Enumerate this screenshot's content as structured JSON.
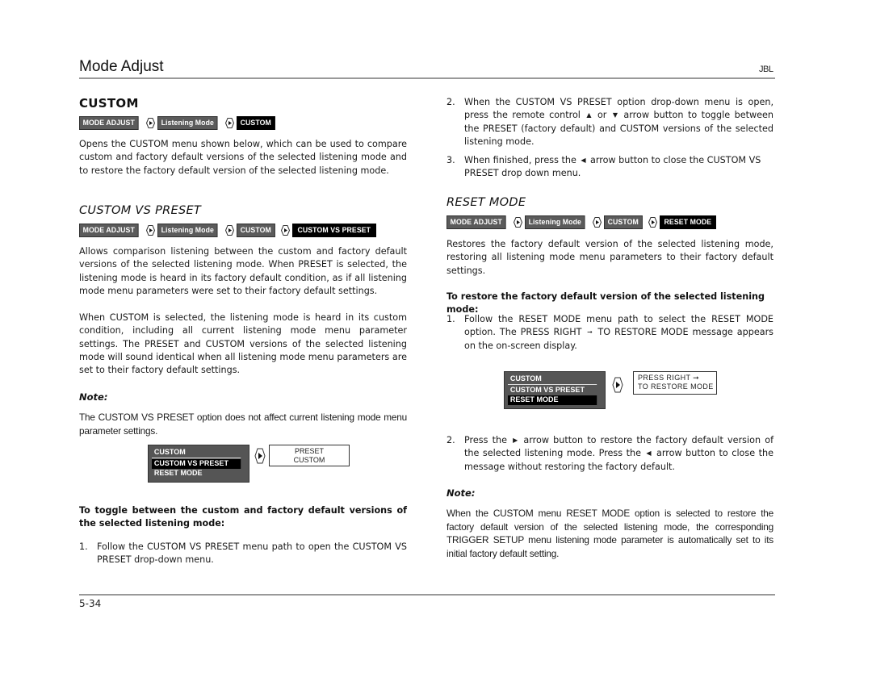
{
  "header": {
    "title": "Mode Adjust",
    "brand": "JBL"
  },
  "footer": {
    "page_number": "5-34"
  },
  "left": {
    "custom": {
      "heading": "CUSTOM",
      "breadcrumb": [
        "MODE ADJUST",
        "Listening Mode",
        "CUSTOM"
      ],
      "body": "Opens the CUSTOM menu shown below, which can be used to compare custom and factory default versions of the selected listening mode and to restore the factory default version of the selected listening mode."
    },
    "custom_vs_preset": {
      "heading": "CUSTOM VS PRESET",
      "breadcrumb": [
        "MODE ADJUST",
        "Listening Mode",
        "CUSTOM",
        "CUSTOM VS PRESET"
      ],
      "para1": "Allows comparison listening between the custom and factory default versions of the selected listening mode. When PRESET is selected, the listening mode is heard in its factory default condition, as if all listening mode menu parameters were set to their factory default settings.",
      "para2": "When CUSTOM is selected, the listening mode is heard in its custom condition, including all current listening mode menu parameter settings. The PRESET and CUSTOM versions of the selected listening mode will sound identical when all listening mode menu parameters are set to their factory default settings.",
      "note_label": "Note:",
      "note_text": "The CUSTOM VS PRESET option does not affect current listening mode menu parameter settings.",
      "menu": {
        "items": [
          "CUSTOM",
          "CUSTOM VS PRESET",
          "RESET MODE"
        ],
        "selected_index": 1
      },
      "display": [
        "PRESET",
        "CUSTOM"
      ],
      "procedure_title": "To toggle between the custom and factory default versions of the selected listening mode:",
      "steps": [
        {
          "num": "1.",
          "text": "Follow the CUSTOM VS PRESET menu path to open the CUSTOM VS PRESET drop-down menu."
        }
      ]
    }
  },
  "right": {
    "steps_cont": [
      {
        "num": "2.",
        "pre": "When the CUSTOM VS PRESET option drop-down menu is open, press the remote control ",
        "arrow1": "▲",
        "mid": " or ",
        "arrow2": "▼",
        "post": " arrow button to toggle between the PRESET (factory default) and CUSTOM versions of the selected listening mode."
      },
      {
        "num": "3.",
        "pre": "When finished, press the ",
        "arrow1": "◀",
        "post": " arrow button to close the CUSTOM VS PRESET drop down menu."
      }
    ],
    "reset_mode": {
      "heading": "RESET MODE",
      "breadcrumb": [
        "MODE ADJUST",
        "Listening Mode",
        "CUSTOM",
        "RESET MODE"
      ],
      "body": "Restores the factory default version of the selected listening mode, restoring all listening mode menu parameters to their factory default settings.",
      "procedure_title": "To restore the factory default version of the selected listening mode:",
      "step1": {
        "num": "1.",
        "pre": "Follow the RESET MODE menu path to select the RESET MODE option. The PRESS RIGHT ",
        "arrow": "➞",
        "post": " TO RESTORE MODE message appears on the on-screen display."
      },
      "menu": {
        "items": [
          "CUSTOM",
          "CUSTOM VS PRESET",
          "RESET MODE"
        ],
        "selected_index": 2
      },
      "display": [
        "PRESS RIGHT ➞",
        "TO RESTORE MODE"
      ],
      "step2": {
        "num": "2.",
        "pre": "Press the ",
        "arrow1": "▶",
        "mid": " arrow button to restore the factory default version of the selected listening mode. Press the ",
        "arrow2": "◀",
        "post": " arrow button to close the message without restoring the factory default."
      },
      "note_label": "Note:",
      "note_text": "When the CUSTOM menu RESET MODE option is selected to restore the factory default version of the selected listening mode, the corresponding TRIGGER SETUP menu listening mode parameter is automatically set to its initial factory default setting."
    }
  },
  "colors": {
    "crumb_bg": "#5b5b5b",
    "crumb_active_bg": "#000000",
    "menu_bg": "#555555",
    "rule": "#999999"
  }
}
